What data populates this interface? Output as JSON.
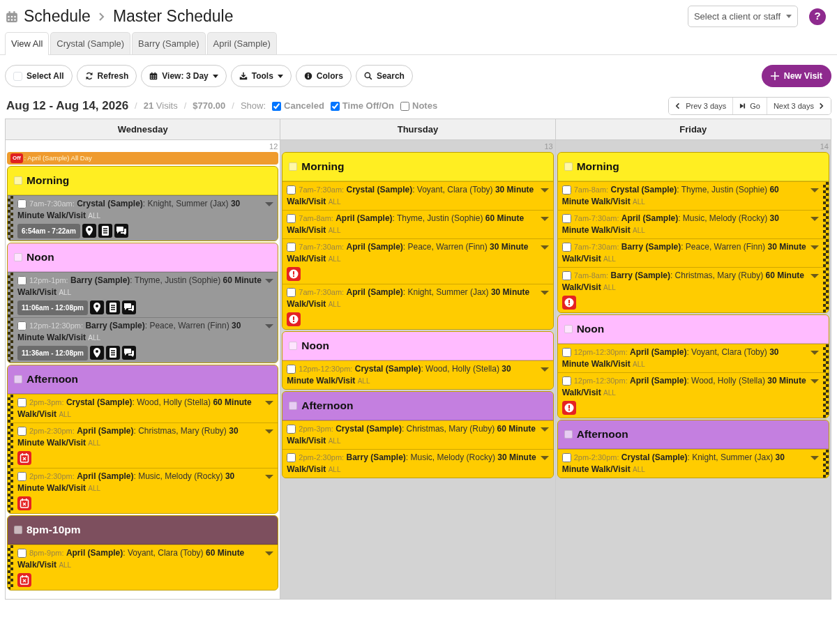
{
  "breadcrumb": {
    "section": "Schedule",
    "page": "Master Schedule"
  },
  "client_select": {
    "placeholder": "Select a client or staff"
  },
  "help": "?",
  "tabs": [
    {
      "label": "View All",
      "selected": true
    },
    {
      "label": "Crystal (Sample)",
      "selected": false
    },
    {
      "label": "Barry (Sample)",
      "selected": false
    },
    {
      "label": "April (Sample)",
      "selected": false
    }
  ],
  "toolbar": [
    {
      "kind": "select_all",
      "label": "Select All",
      "checked": false
    },
    {
      "kind": "refresh",
      "label": "Refresh"
    },
    {
      "kind": "view",
      "label": "View: 3 Day",
      "dropdown": true
    },
    {
      "kind": "tools",
      "label": "Tools",
      "dropdown": true
    },
    {
      "kind": "colors",
      "label": "Colors"
    },
    {
      "kind": "search",
      "label": "Search"
    }
  ],
  "new_visit": "New Visit",
  "summary": [
    {
      "kind": "range",
      "text": "Aug 12 - Aug 14, 2026"
    },
    {
      "kind": "sep",
      "text": "/"
    },
    {
      "kind": "count",
      "text": "**21** Visits"
    },
    {
      "kind": "sep",
      "text": "/"
    },
    {
      "kind": "total",
      "text": "$770.00"
    },
    {
      "kind": "sep",
      "text": "/"
    },
    {
      "kind": "label",
      "text": "Show:"
    }
  ],
  "filters": [
    {
      "label": "Canceled",
      "checked": true
    },
    {
      "label": "Time Off/On",
      "checked": true
    },
    {
      "label": "Notes",
      "checked": false
    }
  ],
  "pager": [
    {
      "kind": "prev",
      "label": "Prev 3 days"
    },
    {
      "kind": "go",
      "label": "Go"
    },
    {
      "kind": "next",
      "label": "Next 3 days"
    }
  ],
  "days": [
    {
      "name": "Wednesday",
      "date": "12",
      "today": true,
      "time_off": [
        {
          "badge": "Off",
          "text": ": April (Sample) All Day"
        }
      ],
      "groups": [
        {
          "label": "Morning",
          "color": "#ffee22",
          "checked": false,
          "visits": [
            {
              "time": "7am-7:30am:",
              "text": "**Crystal (Sample)**: Knight, Summer (Jax) **30 Minute Walk/Visit**",
              "tag": "ALL",
              "color": "#999999",
              "checked": false,
              "left_stripe": true,
              "actual": "6:54am - 7:22am"
            }
          ]
        },
        {
          "label": "Noon",
          "color": "#ffbbff",
          "checked": false,
          "visits": [
            {
              "time": "12pm-1pm:",
              "text": "**Barry (Sample)**: Thyme, Justin (Sophie) **60 Minute Walk/Visit**",
              "tag": "ALL",
              "color": "#999999",
              "checked": false,
              "left_stripe": true,
              "actual": "11:06am - 12:08pm"
            },
            {
              "time": "12pm-12:30pm:",
              "text": "**Barry (Sample)**: Peace, Warren (Finn) **30 Minute Walk/Visit**",
              "tag": "ALL",
              "color": "#999999",
              "checked": false,
              "left_stripe": true,
              "actual": "11:36am - 12:08pm"
            }
          ]
        },
        {
          "label": "Afternoon",
          "color": "#c47fe0",
          "checked": false,
          "visits": [
            {
              "time": "2pm-3pm:",
              "text": "**Crystal (Sample)**: Wood, Holly (Stella) **60 Minute Walk/Visit**",
              "tag": "ALL",
              "color": "#ffcc00",
              "checked": false,
              "left_stripe": true
            },
            {
              "time": "2pm-2:30pm:",
              "text": "**April (Sample)**: Christmas, Mary (Ruby) **30 Minute Walk/Visit**",
              "tag": "ALL",
              "color": "#ffcc00",
              "checked": false,
              "left_stripe": true,
              "canceled": true
            },
            {
              "time": "2pm-2:30pm:",
              "text": "**April (Sample)**: Music, Melody (Rocky) **30 Minute Walk/Visit**",
              "tag": "ALL",
              "color": "#ffcc00",
              "checked": false,
              "left_stripe": true,
              "canceled": true
            }
          ]
        },
        {
          "label": "8pm-10pm",
          "color": "#7d4f5e",
          "checked": false,
          "visits": [
            {
              "time": "8pm-9pm:",
              "text": "**April (Sample)**: Voyant, Clara (Toby) **60 Minute Walk/Visit**",
              "tag": "ALL",
              "color": "#ffcc00",
              "checked": false,
              "left_stripe": true,
              "canceled": true
            }
          ]
        }
      ]
    },
    {
      "name": "Thursday",
      "date": "13",
      "today": false,
      "groups": [
        {
          "label": "Morning",
          "color": "#ffee22",
          "checked": false,
          "visits": [
            {
              "time": "7am-7:30am:",
              "text": "**Crystal (Sample)**: Voyant, Clara (Toby) **30 Minute Walk/Visit**",
              "tag": "ALL",
              "color": "#ffcc00",
              "checked": false
            },
            {
              "time": "7am-8am:",
              "text": "**April (Sample)**: Thyme, Justin (Sophie) **60 Minute Walk/Visit**",
              "tag": "ALL",
              "color": "#ffcc00",
              "checked": false
            },
            {
              "time": "7am-7:30am:",
              "text": "**April (Sample)**: Peace, Warren (Finn) **30 Minute Walk/Visit**",
              "tag": "ALL",
              "color": "#ffcc00",
              "checked": false,
              "alert": true
            },
            {
              "time": "7am-7:30am:",
              "text": "**April (Sample)**: Knight, Summer (Jax) **30 Minute Walk/Visit**",
              "tag": "ALL",
              "color": "#ffcc00",
              "checked": false,
              "alert": true
            }
          ]
        },
        {
          "label": "Noon",
          "color": "#ffbbff",
          "checked": false,
          "visits": [
            {
              "time": "12pm-12:30pm:",
              "text": "**Crystal (Sample)**: Wood, Holly (Stella) **30 Minute Walk/Visit**",
              "tag": "ALL",
              "color": "#ffcc00",
              "checked": false
            }
          ]
        },
        {
          "label": "Afternoon",
          "color": "#c47fe0",
          "checked": false,
          "visits": [
            {
              "time": "2pm-3pm:",
              "text": "**Crystal (Sample)**: Christmas, Mary (Ruby) **60 Minute Walk/Visit**",
              "tag": "ALL",
              "color": "#ffcc00",
              "checked": false
            },
            {
              "time": "2pm-2:30pm:",
              "text": "**Barry (Sample)**: Music, Melody (Rocky) **30 Minute Walk/Visit**",
              "tag": "ALL",
              "color": "#ffcc00",
              "checked": false
            }
          ]
        }
      ]
    },
    {
      "name": "Friday",
      "date": "14",
      "today": false,
      "groups": [
        {
          "label": "Morning",
          "color": "#ffee22",
          "checked": false,
          "visits": [
            {
              "time": "7am-8am:",
              "text": "**Crystal (Sample)**: Thyme, Justin (Sophie) **60 Minute Walk/Visit**",
              "tag": "ALL",
              "color": "#ffcc00",
              "checked": false,
              "right_stripe": true
            },
            {
              "time": "7am-7:30am:",
              "text": "**April (Sample)**: Music, Melody (Rocky) **30 Minute Walk/Visit**",
              "tag": "ALL",
              "color": "#ffcc00",
              "checked": false,
              "right_stripe": true
            },
            {
              "time": "7am-7:30am:",
              "text": "**Barry (Sample)**: Peace, Warren (Finn) **30 Minute Walk/Visit**",
              "tag": "ALL",
              "color": "#ffcc00",
              "checked": false,
              "right_stripe": true
            },
            {
              "time": "7am-8am:",
              "text": "**Barry (Sample)**: Christmas, Mary (Ruby) **60 Minute Walk/Visit**",
              "tag": "ALL",
              "color": "#ffcc00",
              "checked": false,
              "right_stripe": true,
              "alert": true
            }
          ]
        },
        {
          "label": "Noon",
          "color": "#ffbbff",
          "checked": false,
          "visits": [
            {
              "time": "12pm-12:30pm:",
              "text": "**April (Sample)**: Voyant, Clara (Toby) **30 Minute Walk/Visit**",
              "tag": "ALL",
              "color": "#ffcc00",
              "checked": false,
              "right_stripe": true
            },
            {
              "time": "12pm-12:30pm:",
              "text": "**April (Sample)**: Wood, Holly (Stella) **30 Minute Walk/Visit**",
              "tag": "ALL",
              "color": "#ffcc00",
              "checked": false,
              "right_stripe": true,
              "alert": true
            }
          ]
        },
        {
          "label": "Afternoon",
          "color": "#c47fe0",
          "checked": false,
          "visits": [
            {
              "time": "2pm-2:30pm:",
              "text": "**Crystal (Sample)**: Knight, Summer (Jax) **30 Minute Walk/Visit**",
              "tag": "ALL",
              "color": "#ffcc00",
              "checked": false,
              "right_stripe": true
            }
          ]
        }
      ]
    }
  ]
}
